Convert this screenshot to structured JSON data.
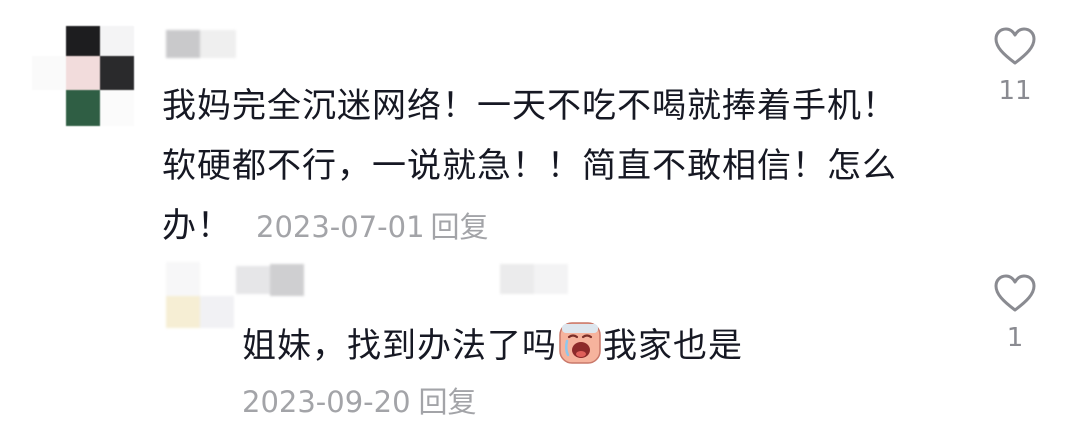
{
  "comment": {
    "text_line1": "我妈完全沉迷网络！一天不吃不喝就捧着手机！",
    "text_line2": "软硬都不行，一说就急！！简直不敢相信！怎么",
    "text_line3": "办！",
    "date": "2023-07-01",
    "reply_label": "回复",
    "like_count": "11",
    "like_icon": "heart-outline-icon"
  },
  "reply": {
    "text_before_emoji": "姐妹，找到办法了吗",
    "emoji": "crying-face-emoji",
    "text_after_emoji": "我家也是",
    "date": "2023-09-20",
    "reply_label": "回复",
    "like_count": "1",
    "like_icon": "heart-outline-icon"
  },
  "colors": {
    "text_primary": "#161823",
    "text_meta": "#a3a4a8",
    "like_count": "#8a8b91",
    "icon_stroke": "#8a8b91"
  }
}
